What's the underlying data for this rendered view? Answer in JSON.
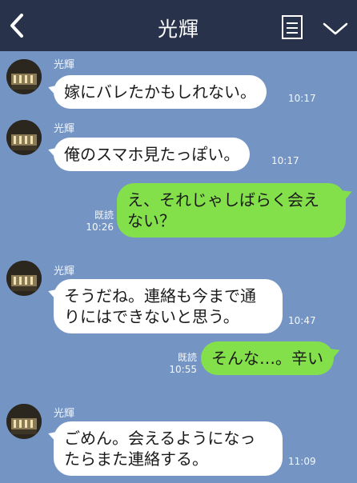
{
  "header": {
    "title": "光輝",
    "back_icon": "chevron-left-icon",
    "menu_icon": "note-list-icon",
    "dropdown_icon": "chevron-down-icon"
  },
  "messages": [
    {
      "direction": "incoming",
      "sender": "光輝",
      "lines": [
        "嫁にバレたかもしれない。"
      ],
      "time": "10:17"
    },
    {
      "direction": "incoming",
      "sender": "光輝",
      "lines": [
        "俺のスマホ見たっぽい。"
      ],
      "time": "10:17"
    },
    {
      "direction": "outgoing",
      "lines": [
        "え、それじゃしばらく会え",
        "ない？"
      ],
      "read": "既読",
      "time": "10:26"
    },
    {
      "direction": "incoming",
      "sender": "光輝",
      "lines": [
        "そうだね。連絡も今まで通",
        "りにはできないと思う。"
      ],
      "time": "10:47"
    },
    {
      "direction": "outgoing",
      "lines": [
        "そんな…。辛い"
      ],
      "read": "既読",
      "time": "10:55"
    },
    {
      "direction": "incoming",
      "sender": "光輝",
      "lines": [
        "ごめん。会えるようになっ",
        "たらまた連絡する。"
      ],
      "time": "11:09"
    }
  ],
  "colors": {
    "header_bg": "#28324a",
    "chat_bg": "#7495c3",
    "incoming_bubble": "#ffffff",
    "outgoing_bubble": "#84e04a"
  }
}
